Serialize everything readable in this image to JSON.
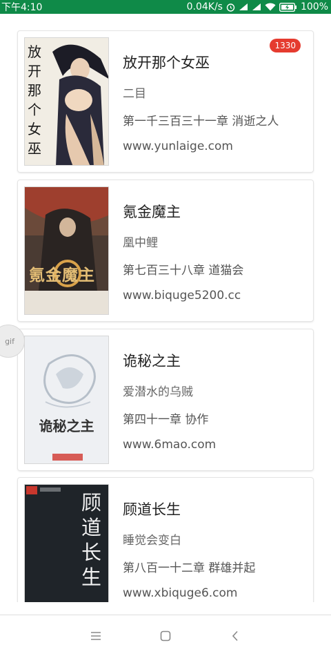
{
  "status_bar": {
    "time": "下午4:10",
    "speed": "0.04K/s",
    "battery": "100%"
  },
  "books": [
    {
      "title": "放开那个女巫",
      "author": "二目",
      "chapter": "第一千三百三十一章 消逝之人",
      "source": "www.yunlaige.com",
      "badge": "1330",
      "cover_text": "放开那个女巫"
    },
    {
      "title": "氪金魔主",
      "author": "凰中鲤",
      "chapter": "第七百三十八章 道猫会",
      "source": "www.biquge5200.cc",
      "cover_text": "氪金魔主"
    },
    {
      "title": "诡秘之主",
      "author": "爱潜水的乌贼",
      "chapter": "第四十一章 协作",
      "source": "www.6mao.com",
      "cover_text": "诡秘之主"
    },
    {
      "title": "顾道长生",
      "author": "睡觉会变白",
      "chapter": "第八百一十二章 群雄并起",
      "source": "www.xbiquge6.com",
      "cover_text": "顾道长生"
    }
  ],
  "gif_tab": "gif",
  "colors": {
    "status_bar": "#0f8a48",
    "badge": "#e53b2f"
  }
}
